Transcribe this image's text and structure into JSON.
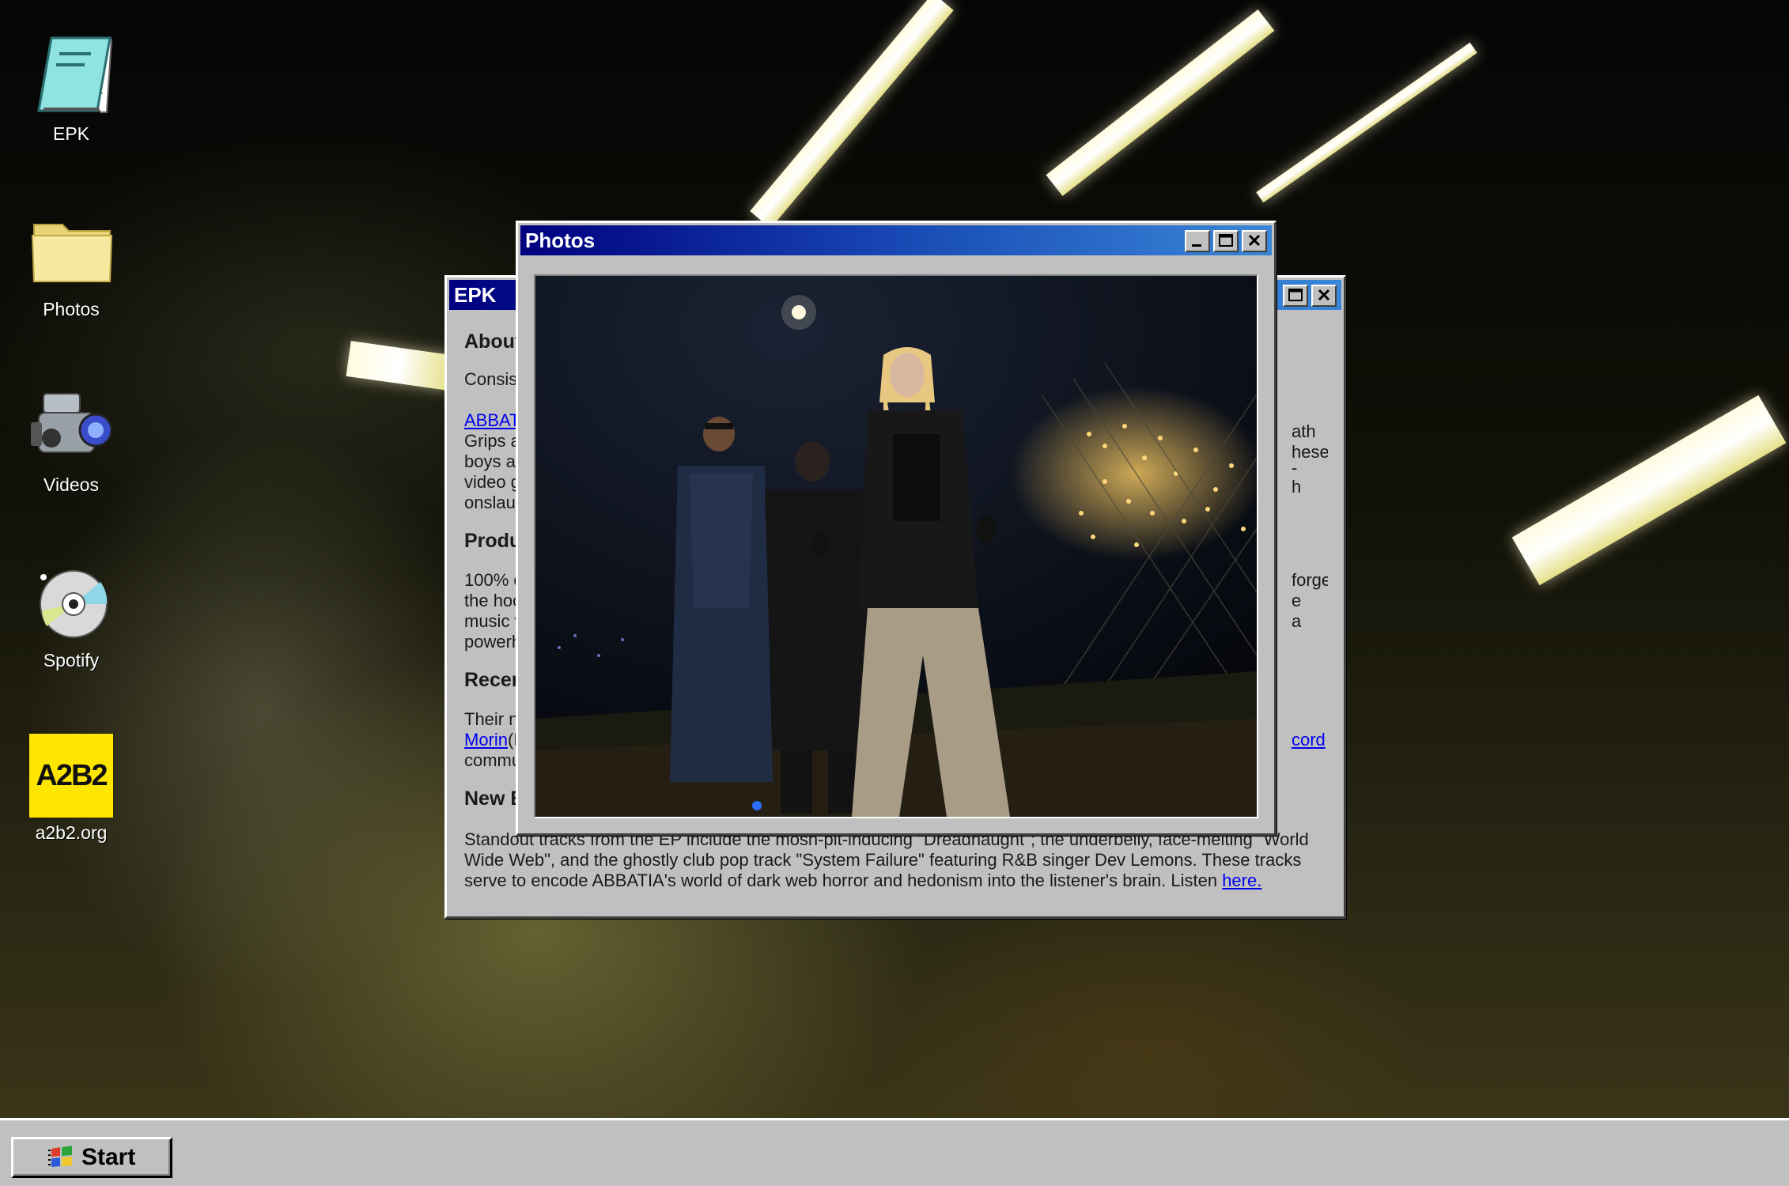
{
  "desktop": {
    "icons": [
      {
        "label": "EPK",
        "icon": "notepad-icon"
      },
      {
        "label": "Photos",
        "icon": "folder-icon"
      },
      {
        "label": "Videos",
        "icon": "camcorder-icon"
      },
      {
        "label": "Spotify",
        "icon": "cd-icon"
      },
      {
        "label": "a2b2.org",
        "icon": "a2b2-logo-icon",
        "logo_text": "A2B2",
        "logo_color": "#ffe600"
      }
    ]
  },
  "epk_window": {
    "title": "EPK",
    "left_fragments": {
      "about_heading": "About",
      "consis": "Consis",
      "abbat_link": "ABBAT",
      "grips": "Grips a",
      "boys": "boys ar",
      "video": "video g",
      "onslau": "onslau",
      "produ_heading": "Produ",
      "pct": "100% o",
      "the_hoo": "the hoo",
      "music": "music v",
      "powerh": "powerh",
      "recen_heading": "Recen",
      "their": "Their n",
      "morin_link": "Morin",
      "morin_rest": "(R",
      "commu": "commu",
      "new_heading": "New E"
    },
    "right_fragments": {
      "ath": "ath",
      "hese": "hese",
      "tick": "-",
      "h": "h",
      "forges": "forges",
      "e": "e",
      "a": "a",
      "cord_link": "cord"
    },
    "bottom_paragraph": "Standout tracks from the EP include the mosh-pit-inducing \"Dreadnaught\"; the underbelly, face-melting \"World Wide Web\", and the ghostly club pop track \"System Failure\" featuring R&B singer Dev Lemons. These tracks serve to encode ABBATIA's world of dark web horror and hedonism into the listener's brain. Listen",
    "bottom_link": "here."
  },
  "photos_window": {
    "title": "Photos",
    "carousel_indicator_color": "#2a6cff"
  },
  "titlebar_buttons": {
    "minimize": "minimize-icon",
    "maximize": "maximize-icon",
    "close": "close-icon"
  },
  "taskbar": {
    "start_label": "Start"
  },
  "colors": {
    "titlebar_start": "#000080",
    "titlebar_end": "#3a86d8",
    "window_face": "#c0c0c0",
    "link": "#0000ee"
  }
}
